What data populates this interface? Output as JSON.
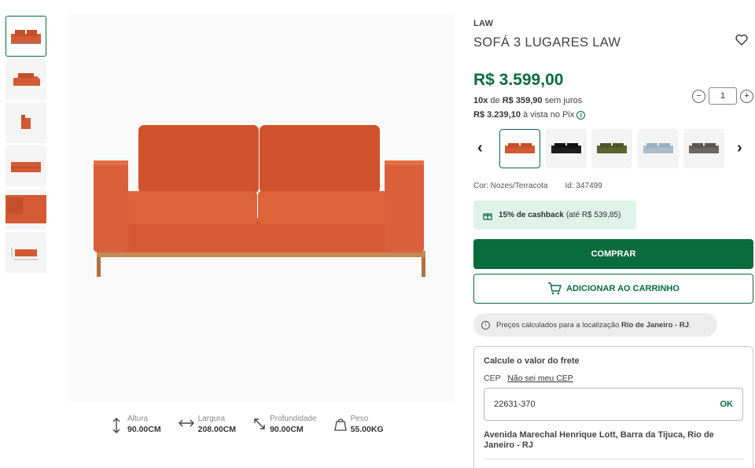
{
  "product": {
    "brand": "LAW",
    "title": "SOFÁ 3 LUGARES LAW",
    "price": "R$ 3.599,00",
    "installments": {
      "count": "10x",
      "de": "de",
      "amount": "R$ 359,90",
      "suffix": "sem juros"
    },
    "pix": {
      "amount": "R$ 3.239,10",
      "suffix": "à vista no Pix"
    },
    "quantity": "1",
    "color": "Cor: Nozes/Terracota",
    "id": "Id: 347499",
    "cashback": {
      "highlight": "15% de cashback",
      "detail": "(até R$ 539,85)"
    },
    "buy_label": "COMPRAR",
    "cart_label": "ADICIONAR AO CARRINHO",
    "location": {
      "prefix": "Preços calculados para a localização",
      "city": "Rio de Janeiro - RJ",
      "suffix": "."
    }
  },
  "variants": [
    {
      "color": "#d35a33",
      "name": "terracota"
    },
    {
      "color": "#1e1e1e",
      "name": "preto"
    },
    {
      "color": "#5b6331",
      "name": "verde"
    },
    {
      "color": "#a9bdcc",
      "name": "azul"
    },
    {
      "color": "#6a6764",
      "name": "cinza"
    }
  ],
  "dimensions": [
    {
      "label": "Altura",
      "value": "90.00CM",
      "icon": "height-icon"
    },
    {
      "label": "Largura",
      "value": "208.00CM",
      "icon": "width-icon"
    },
    {
      "label": "Profundidade",
      "value": "90.00CM",
      "icon": "depth-icon"
    },
    {
      "label": "Peso",
      "value": "55.00KG",
      "icon": "weight-icon"
    }
  ],
  "freight": {
    "title": "Calcule o valor do frete",
    "cep_label": "CEP",
    "cep_link": "Não sei meu CEP",
    "cep_value": "22631-370",
    "ok_label": "OK",
    "address": "Avenida Marechal Henrique Lott, Barra da Tijuca, Rio de Janeiro - RJ"
  },
  "colors": {
    "brand_green": "#0a6b3d",
    "sofa": "#d35a33",
    "cashback_bg": "#dff3ea"
  }
}
